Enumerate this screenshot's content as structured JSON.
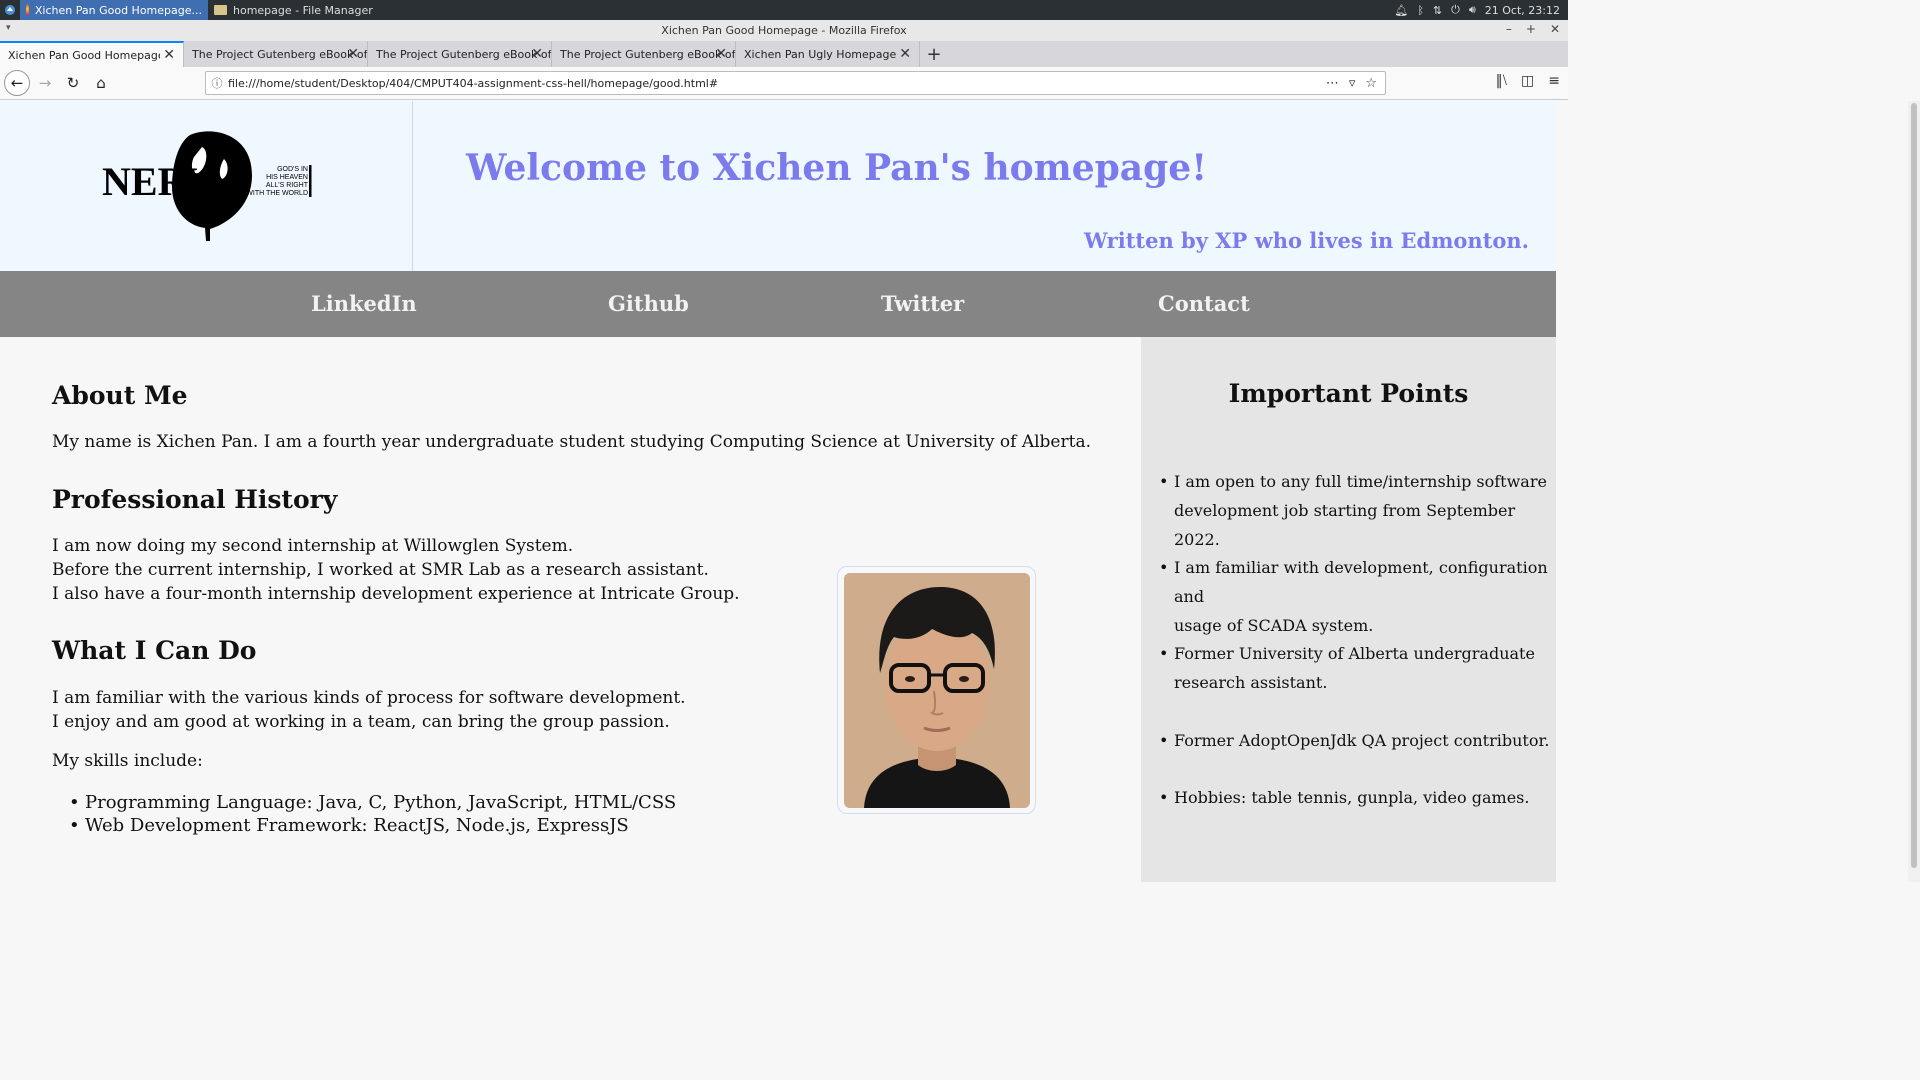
{
  "taskbar": {
    "tasks": [
      {
        "label": "Xichen Pan Good Homepage..."
      },
      {
        "label": "homepage - File Manager"
      }
    ],
    "clock": "21 Oct, 23:12"
  },
  "window": {
    "title": "Xichen Pan Good Homepage - Mozilla Firefox"
  },
  "tabs": [
    {
      "label": "Xichen Pan Good Homepage"
    },
    {
      "label": "The Project Gutenberg eBook of A"
    },
    {
      "label": "The Project Gutenberg eBook of D"
    },
    {
      "label": "The Project Gutenberg eBook of F"
    },
    {
      "label": "Xichen Pan Ugly Homepage"
    }
  ],
  "urlbar": {
    "url": "file:///home/student/Desktop/404/CMPUT404-assignment-css-hell/homepage/good.html#"
  },
  "header": {
    "logo": {
      "main": "NERV",
      "motto_lines": [
        "GOD'S IN",
        "HIS HEAVEN",
        "ALL'S RIGHT",
        "WITH THE WORLD"
      ]
    },
    "title": "Welcome to Xichen Pan's homepage!",
    "byline": "Written by XP who lives in Edmonton."
  },
  "menu": [
    {
      "label": "LinkedIn"
    },
    {
      "label": "Github"
    },
    {
      "label": "Twitter"
    },
    {
      "label": "Contact"
    }
  ],
  "about": {
    "heading": "About Me",
    "text": "My name is Xichen Pan. I am a fourth year undergraduate student studying Computing Science at University of Alberta."
  },
  "history": {
    "heading": "Professional History",
    "lines": [
      "I am now doing my second internship at Willowglen System.",
      "Before the current internship, I worked at SMR Lab as a research assistant.",
      "I also have a four-month internship development experience at Intricate Group."
    ]
  },
  "cando": {
    "heading": "What I Can Do",
    "lines": [
      "I am familiar with the various kinds of process for software development.",
      "I enjoy and am good at working in a team, can bring the group passion."
    ],
    "skills_intro": "My skills include:",
    "skills": [
      "Programming Language: Java, C, Python, JavaScript, HTML/CSS",
      "Web Development Framework: ReactJS, Node.js, ExpressJS"
    ]
  },
  "aside": {
    "heading": "Important Points",
    "points": [
      [
        "I am open to any full time/internship software",
        "development job starting from September 2022."
      ],
      [
        "I am familiar with development, configuration and",
        "usage of SCADA system."
      ],
      [
        "Former University of Alberta undergraduate",
        "research assistant."
      ],
      [
        "Former AdoptOpenJdk QA project contributor."
      ],
      [
        "Hobbies: table tennis, gunpla, video games."
      ]
    ]
  },
  "colors": {
    "accent": "#7b7bee",
    "menu_bg": "#858585",
    "header_bg": "#f0f8ff",
    "aside_bg": "#e5e5e5"
  }
}
